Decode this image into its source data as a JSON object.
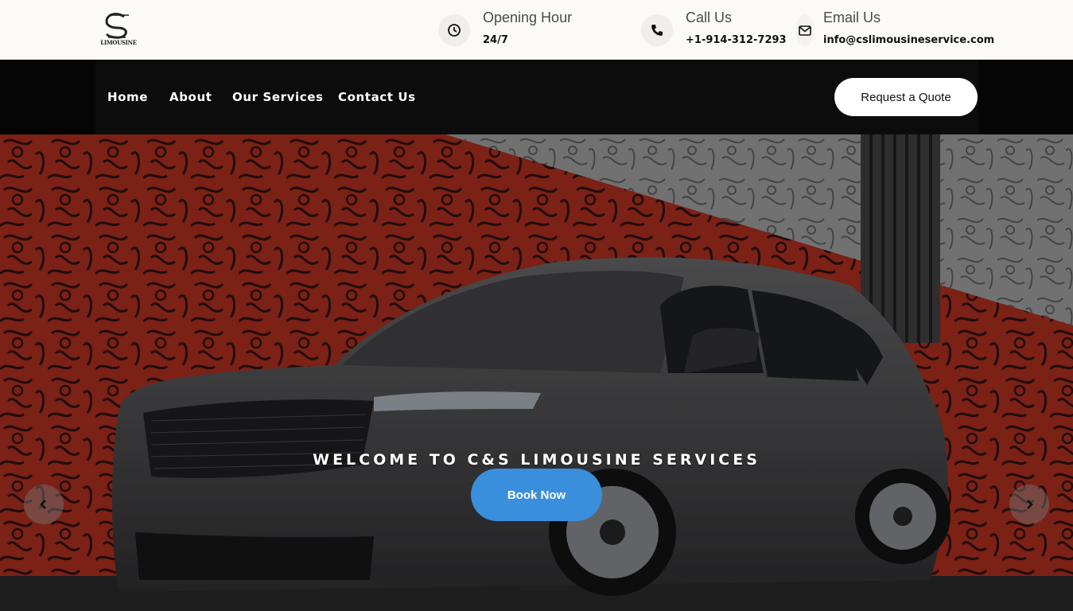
{
  "brand": {
    "logo_text": "LIMOUSINE"
  },
  "contact": {
    "hours": {
      "title": "Opening Hour",
      "value": "24/7",
      "icon": "clock-icon"
    },
    "phone": {
      "title": "Call Us",
      "value": "+1-914-312-7293",
      "icon": "phone-icon"
    },
    "email": {
      "title": "Email Us",
      "value": "info@cslimousineservice.com",
      "icon": "envelope-icon"
    }
  },
  "nav": {
    "items": [
      {
        "label": "Home"
      },
      {
        "label": "About"
      },
      {
        "label": "Our Services"
      },
      {
        "label": "Contact Us"
      }
    ],
    "quote_label": "Request a Quote"
  },
  "hero": {
    "heading": "WELCOME TO C&S LIMOUSINE SERVICES",
    "cta_label": "Book Now",
    "prev_icon": "chevron-left-icon",
    "next_icon": "chevron-right-icon"
  },
  "colors": {
    "topbar_bg": "#fbfaf9",
    "nav_bg": "#050505",
    "cta": "#3a8fdc",
    "mural_red": "#9a2a1c"
  }
}
